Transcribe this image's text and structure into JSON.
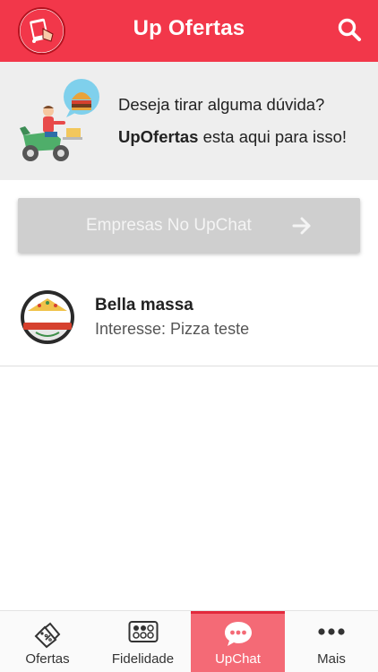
{
  "header": {
    "title": "Up Ofertas",
    "logo_icon": "upofertas-logo-icon",
    "search_icon": "search-icon"
  },
  "banner": {
    "line1": "Deseja tirar alguma dúvida?",
    "line2_brand": "UpOfertas",
    "line2_rest": " esta aqui para isso!",
    "illustration_icon": "delivery-scooter-icon"
  },
  "cta": {
    "label": "Empresas No UpChat",
    "arrow_icon": "arrow-right-icon"
  },
  "chats": [
    {
      "name": "Bella massa",
      "subtitle": "Interesse: Pizza teste",
      "avatar_icon": "bella-massa-logo"
    }
  ],
  "tabs": [
    {
      "label": "Ofertas",
      "icon": "tags-icon"
    },
    {
      "label": "Fidelidade",
      "icon": "loyalty-card-icon"
    },
    {
      "label": "UpChat",
      "icon": "chat-bubble-icon"
    },
    {
      "label": "Mais",
      "icon": "more-dots-icon"
    }
  ],
  "colors": {
    "primary": "#f2374a",
    "active_tab": "#f46a76",
    "cta_bg": "#cfcfcf",
    "banner_bg": "#eeeeee"
  }
}
